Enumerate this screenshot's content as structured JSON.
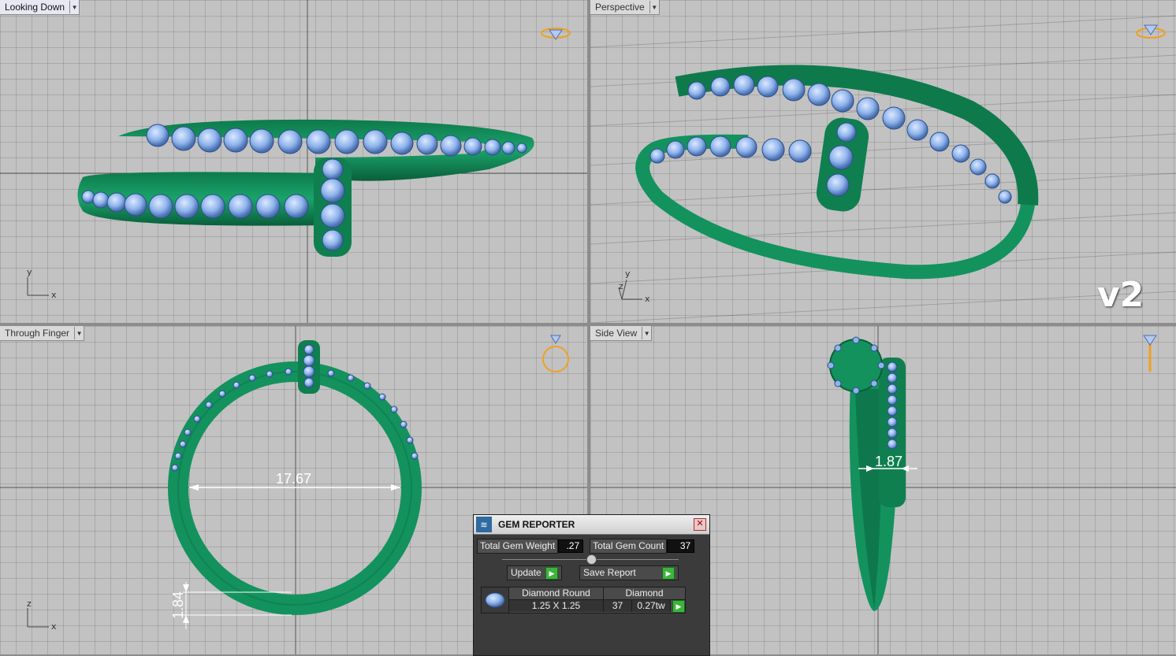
{
  "viewports": {
    "top_left": {
      "label": "Looking Down",
      "axis_labels": [
        "y",
        "x"
      ]
    },
    "top_right": {
      "label": "Perspective",
      "axis_labels": [
        "y",
        "z",
        "x"
      ],
      "badge": "v2"
    },
    "bottom_left": {
      "label": "Through Finger",
      "axis_labels": [
        "z",
        "x"
      ],
      "dimensions": {
        "inner_diameter": "17.67",
        "band_thickness": "1.84"
      }
    },
    "bottom_right": {
      "label": "Side View",
      "dimensions": {
        "band_width": "1.87"
      }
    }
  },
  "gem_reporter": {
    "title": "GEM REPORTER",
    "total_gem_weight_label": "Total Gem Weight",
    "total_gem_weight_value": ".27",
    "total_gem_count_label": "Total Gem Count",
    "total_gem_count_value": "37",
    "update_label": "Update",
    "save_report_label": "Save Report",
    "table": {
      "headers": [
        "Diamond Round",
        "Diamond"
      ],
      "row": {
        "size": "1.25 X 1.25",
        "count": "37",
        "weight": "0.27tw"
      }
    }
  },
  "colors": {
    "metal": "#13925e",
    "metal_dark": "#0a5e3a",
    "gem": "#8fb4ec",
    "viewport_bg": "#c2c2c2",
    "widget_orange": "#f0a020"
  }
}
